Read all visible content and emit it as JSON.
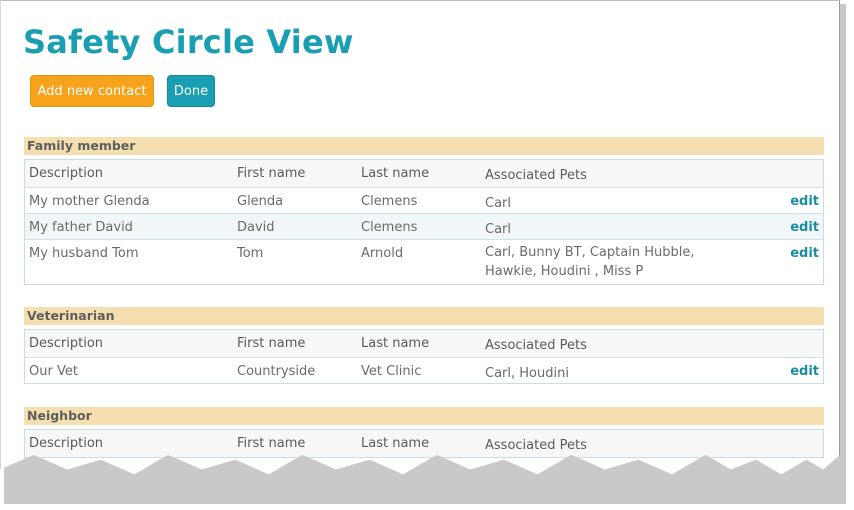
{
  "page": {
    "title": "Safety Circle View"
  },
  "actions": {
    "add_label": "Add new contact",
    "done_label": "Done"
  },
  "columns": [
    "Description",
    "First name",
    "Last name",
    "Associated Pets"
  ],
  "edit_label": "edit",
  "sections": [
    {
      "title": "Family member",
      "rows": [
        {
          "description": "My mother Glenda",
          "first": "Glenda",
          "last": "Clemens",
          "pets": "Carl"
        },
        {
          "description": "My father David",
          "first": "David",
          "last": "Clemens",
          "pets": "Carl"
        },
        {
          "description": "My husband Tom",
          "first": "Tom",
          "last": "Arnold",
          "pets": "Carl, Bunny BT, Captain Hubble, Hawkie, Houdini , Miss P"
        }
      ]
    },
    {
      "title": "Veterinarian",
      "rows": [
        {
          "description": "Our Vet",
          "first": "Countryside",
          "last": "Vet Clinic",
          "pets": "Carl, Houdini"
        }
      ]
    },
    {
      "title": "Neighbor",
      "rows": []
    }
  ]
}
